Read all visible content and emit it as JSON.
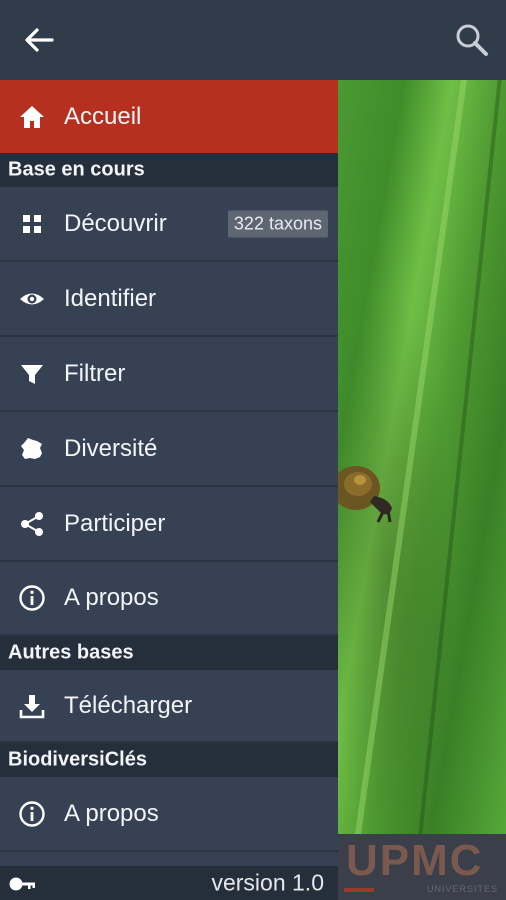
{
  "appbar": {
    "back_icon": "arrow-left-icon",
    "search_icon": "search-icon"
  },
  "drawer": {
    "home": {
      "label": "Accueil",
      "icon": "home-icon"
    },
    "section_current": "Base en cours",
    "current_items": [
      {
        "label": "Découvrir",
        "icon": "grid-icon",
        "badge": "322 taxons"
      },
      {
        "label": "Identifier",
        "icon": "eye-icon"
      },
      {
        "label": "Filtrer",
        "icon": "filter-icon"
      },
      {
        "label": "Diversité",
        "icon": "france-map-icon"
      },
      {
        "label": "Participer",
        "icon": "share-icon"
      },
      {
        "label": "A propos",
        "icon": "info-icon"
      }
    ],
    "section_other": "Autres bases",
    "other_items": [
      {
        "label": "Télécharger",
        "icon": "download-icon"
      }
    ],
    "section_app": "BiodiversiClés",
    "app_items": [
      {
        "label": "A propos",
        "icon": "info-icon"
      }
    ],
    "footer": {
      "version": "version 1.0",
      "icon": "key-icon"
    }
  },
  "background": {
    "logo_text": "UPMC",
    "logo_sub": "UNIVERSITES"
  },
  "colors": {
    "drawer_bg": "#364253",
    "section_bg": "#252f3b",
    "active_bg": "#b5301f",
    "appbar_bg": "#313c4b"
  }
}
